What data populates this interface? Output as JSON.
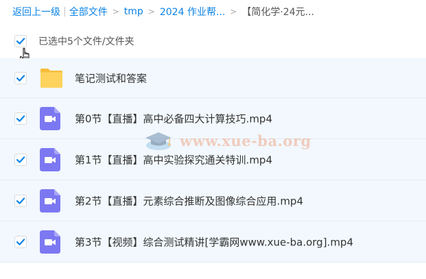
{
  "breadcrumb": {
    "back": "返回上一级",
    "pipe": "|",
    "items": [
      "全部文件",
      "tmp",
      "2024 作业帮..."
    ],
    "current": "【简化学·24元...",
    "separator": ">"
  },
  "selection": {
    "label": "已选中5个文件/文件夹",
    "checked": true
  },
  "files": [
    {
      "name": "笔记测试和答案",
      "type": "folder",
      "checked": true
    },
    {
      "name": "第0节【直播】高中必备四大计算技巧.mp4",
      "type": "video",
      "checked": true
    },
    {
      "name": "第1节【直播】高中实验探究通关特训.mp4",
      "type": "video",
      "checked": true
    },
    {
      "name": "第2节【直播】元素综合推断及图像综合应用.mp4",
      "type": "video",
      "checked": true
    },
    {
      "name": "第3节【视频】综合测试精讲[学霸网www.xue-ba.org].mp4",
      "type": "video",
      "checked": true
    }
  ],
  "watermark": "www.xue-ba.org",
  "colors": {
    "link": "#0b83e6",
    "check": "#0b83e6",
    "row_bg": "#f2f8fd",
    "folder": "#fdd35e",
    "video": "#7c78f2"
  },
  "icons": {
    "folder": "folder-icon",
    "video": "video-file-icon",
    "check": "checkmark-icon",
    "cursor": "hand-pointer-icon"
  }
}
